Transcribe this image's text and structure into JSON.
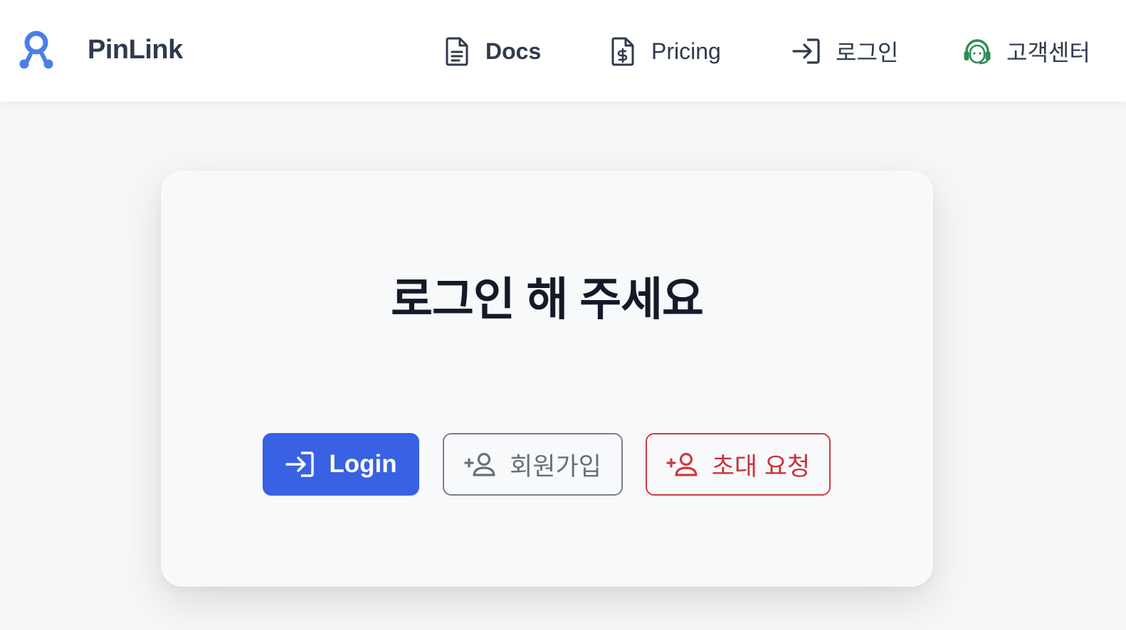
{
  "header": {
    "brand_name": "PinLink",
    "nav": {
      "docs_label": "Docs",
      "pricing_label": "Pricing",
      "login_label": "로그인",
      "support_label": "고객센터"
    }
  },
  "main": {
    "title": "로그인 해 주세요",
    "buttons": {
      "login_label": "Login",
      "signup_label": "회원가입",
      "invite_label": "초대 요청"
    }
  },
  "colors": {
    "brand_blue": "#3861e3",
    "invite_red": "#cf3b40",
    "support_green": "#2e8b57",
    "logo_blue": "#4a7fe8"
  },
  "icons": {
    "logo": "pinlink-logo-icon",
    "docs": "document-icon",
    "pricing": "price-document-icon",
    "login": "login-arrow-icon",
    "support": "headset-icon",
    "signup": "add-user-icon",
    "invite": "add-user-icon"
  }
}
